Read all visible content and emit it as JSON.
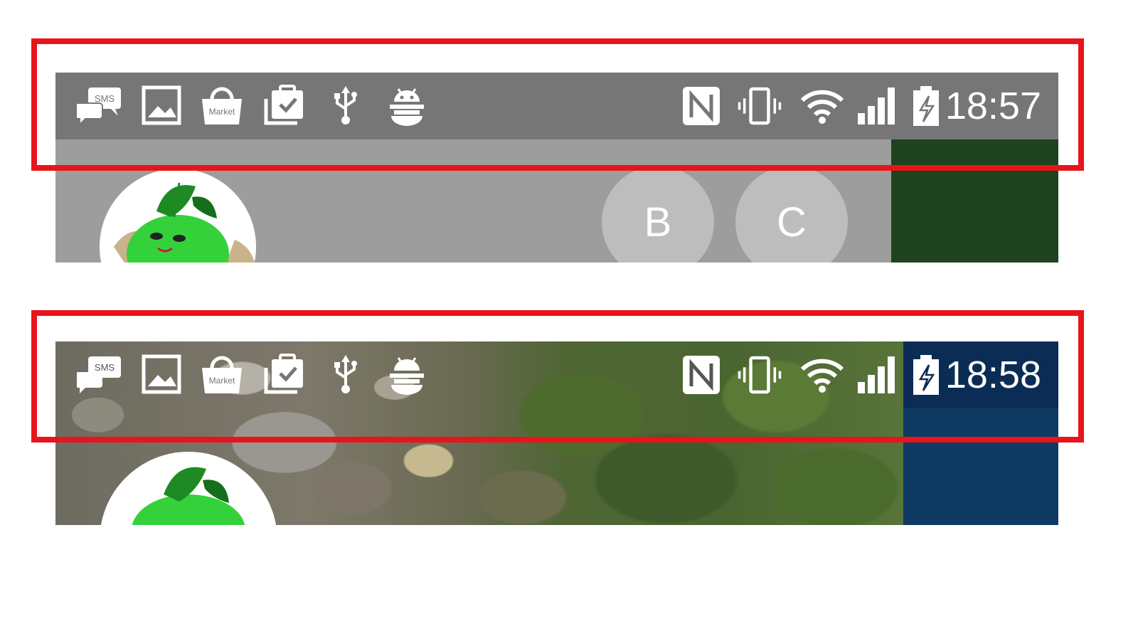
{
  "screens": [
    {
      "status_bar": {
        "time": "18:57",
        "left_icons": [
          "sms-icon",
          "image-icon",
          "market-icon",
          "clipboard-check-icon",
          "usb-icon",
          "android-debug-icon"
        ],
        "right_icons": [
          "nfc-icon",
          "vibrate-icon",
          "wifi-icon",
          "signal-icon",
          "battery-charging-icon"
        ],
        "sms_label": "SMS",
        "market_label": "Market"
      },
      "contacts": [
        {
          "letter": "B"
        },
        {
          "letter": "C"
        }
      ],
      "colors": {
        "status_bar": "#767676",
        "panel": "#9d9d9d",
        "accent": "#1f431f"
      }
    },
    {
      "status_bar": {
        "time": "18:58",
        "left_icons": [
          "sms-icon",
          "image-icon",
          "market-icon",
          "clipboard-check-icon",
          "usb-icon",
          "android-debug-icon"
        ],
        "right_icons": [
          "nfc-icon",
          "vibrate-icon",
          "wifi-icon",
          "signal-icon",
          "battery-charging-icon"
        ],
        "sms_label": "SMS",
        "market_label": "Market"
      },
      "colors": {
        "accent": "#0f3a63",
        "highlight_frame": "#e8141b"
      }
    }
  ]
}
